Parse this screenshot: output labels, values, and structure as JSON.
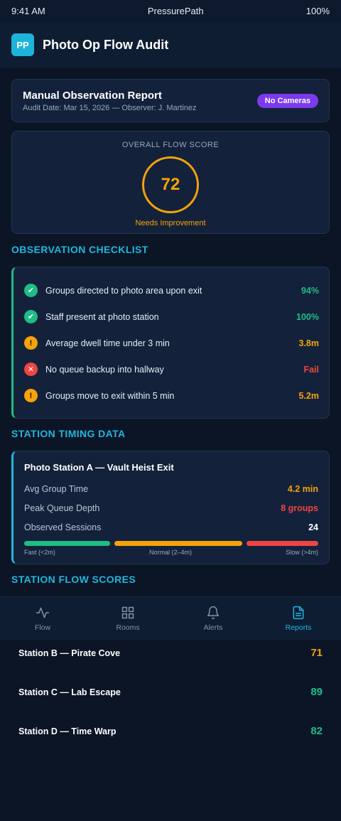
{
  "status": {
    "time": "9:41 AM",
    "app": "PressurePath",
    "battery": "100%"
  },
  "header": {
    "logo": "PP",
    "title": "Photo Op Flow Audit"
  },
  "report": {
    "title": "Manual Observation Report",
    "meta": "Audit Date: Mar 15, 2026 — Observer: J. Martinez",
    "badge": "No Cameras"
  },
  "score": {
    "label": "OVERALL FLOW SCORE",
    "value": "72",
    "status": "Needs Improvement"
  },
  "checklist": {
    "title": "OBSERVATION CHECKLIST",
    "items": [
      {
        "text": "Groups directed to photo area upon exit",
        "value": "94%",
        "state": "pass"
      },
      {
        "text": "Staff present at photo station",
        "value": "100%",
        "state": "pass"
      },
      {
        "text": "Average dwell time under 3 min",
        "value": "3.8m",
        "state": "warn"
      },
      {
        "text": "No queue backup into hallway",
        "value": "Fail",
        "state": "fail"
      },
      {
        "text": "Groups move to exit within 5 min",
        "value": "5.2m",
        "state": "warn"
      }
    ]
  },
  "timing": {
    "section_title": "STATION TIMING DATA",
    "card_title": "Photo Station A — Vault Heist Exit",
    "rows": [
      {
        "label": "Avg Group Time",
        "value": "4.2 min"
      },
      {
        "label": "Peak Queue Depth",
        "value": "8 groups"
      },
      {
        "label": "Observed Sessions",
        "value": "24"
      }
    ],
    "bar_labels": {
      "fast": "Fast (<2m)",
      "normal": "Normal (2–4m)",
      "slow": "Slow (>4m)"
    }
  },
  "flow_scores": {
    "title": "STATION FLOW SCORES",
    "stations": [
      {
        "name": "Station B — Pirate Cove",
        "score": "71"
      },
      {
        "name": "Station C — Lab Escape",
        "score": "89"
      },
      {
        "name": "Station D — Time Warp",
        "score": "82"
      }
    ]
  },
  "nav": {
    "items": [
      {
        "label": "Flow",
        "icon": "activity-icon"
      },
      {
        "label": "Rooms",
        "icon": "grid-icon"
      },
      {
        "label": "Alerts",
        "icon": "bell-icon"
      },
      {
        "label": "Reports",
        "icon": "document-icon"
      }
    ]
  },
  "colors": {
    "accent": "#1fb7dd",
    "pass": "#1ebd85",
    "warn": "#f5a20c",
    "fail": "#ef4444",
    "badge": "#7c3aed"
  }
}
